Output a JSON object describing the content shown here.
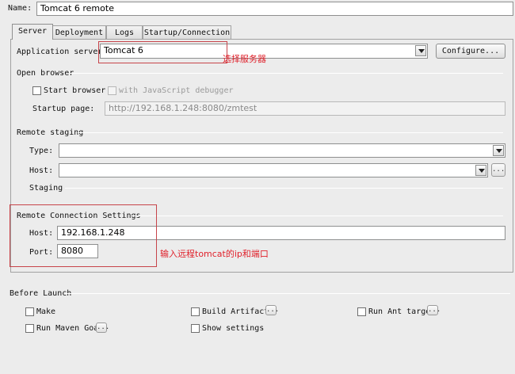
{
  "name_field": {
    "label": "Name:",
    "value": "Tomcat 6 remote"
  },
  "tabs": [
    {
      "label": "Server",
      "active": true
    },
    {
      "label": "Deployment",
      "active": false
    },
    {
      "label": "Logs",
      "active": false
    },
    {
      "label": "Startup/Connection",
      "active": false
    }
  ],
  "server": {
    "app_server_label": "Application server:",
    "app_server_value": "Tomcat 6",
    "configure_label": "Configure..."
  },
  "open_browser": {
    "section_label": "Open browser",
    "start_browser_label": "Start browser",
    "js_debugger_label": "with JavaScript debugger",
    "startup_page_label": "Startup page:",
    "startup_page_value": "http://192.168.1.248:8080/zmtest"
  },
  "remote_staging": {
    "section_label": "Remote staging",
    "type_label": "Type:",
    "type_value": "",
    "host_label": "Host:",
    "host_value": "",
    "host_more": "...",
    "staging_label": "Staging"
  },
  "remote_connection": {
    "section_label": "Remote Connection Settings",
    "host_label": "Host:",
    "host_value": "192.168.1.248",
    "port_label": "Port:",
    "port_value": "8080"
  },
  "annotations": {
    "select_server": "选择服务器",
    "enter_ip_port": "输入远程tomcat的ip和端口"
  },
  "before_launch": {
    "section_label": "Before Launch",
    "make_label": "Make",
    "build_artifacts_label": "Build Artifacts",
    "run_ant_label": "Run Ant target",
    "run_maven_label": "Run Maven Goal",
    "show_settings_label": "Show settings",
    "more": "..."
  },
  "colors": {
    "annotation": "#e0212b",
    "annotation_box": "#c7444a"
  }
}
